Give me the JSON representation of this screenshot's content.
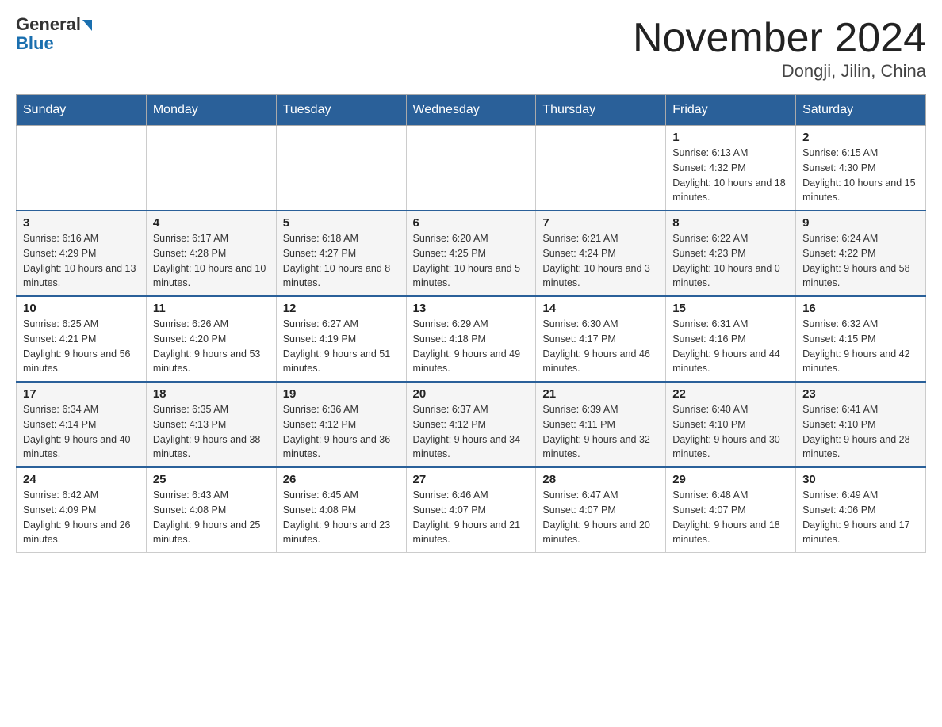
{
  "header": {
    "logo_general": "General",
    "logo_blue": "Blue",
    "title": "November 2024",
    "subtitle": "Dongji, Jilin, China"
  },
  "calendar": {
    "days_of_week": [
      "Sunday",
      "Monday",
      "Tuesday",
      "Wednesday",
      "Thursday",
      "Friday",
      "Saturday"
    ],
    "weeks": [
      [
        {
          "day": "",
          "info": ""
        },
        {
          "day": "",
          "info": ""
        },
        {
          "day": "",
          "info": ""
        },
        {
          "day": "",
          "info": ""
        },
        {
          "day": "",
          "info": ""
        },
        {
          "day": "1",
          "info": "Sunrise: 6:13 AM\nSunset: 4:32 PM\nDaylight: 10 hours and 18 minutes."
        },
        {
          "day": "2",
          "info": "Sunrise: 6:15 AM\nSunset: 4:30 PM\nDaylight: 10 hours and 15 minutes."
        }
      ],
      [
        {
          "day": "3",
          "info": "Sunrise: 6:16 AM\nSunset: 4:29 PM\nDaylight: 10 hours and 13 minutes."
        },
        {
          "day": "4",
          "info": "Sunrise: 6:17 AM\nSunset: 4:28 PM\nDaylight: 10 hours and 10 minutes."
        },
        {
          "day": "5",
          "info": "Sunrise: 6:18 AM\nSunset: 4:27 PM\nDaylight: 10 hours and 8 minutes."
        },
        {
          "day": "6",
          "info": "Sunrise: 6:20 AM\nSunset: 4:25 PM\nDaylight: 10 hours and 5 minutes."
        },
        {
          "day": "7",
          "info": "Sunrise: 6:21 AM\nSunset: 4:24 PM\nDaylight: 10 hours and 3 minutes."
        },
        {
          "day": "8",
          "info": "Sunrise: 6:22 AM\nSunset: 4:23 PM\nDaylight: 10 hours and 0 minutes."
        },
        {
          "day": "9",
          "info": "Sunrise: 6:24 AM\nSunset: 4:22 PM\nDaylight: 9 hours and 58 minutes."
        }
      ],
      [
        {
          "day": "10",
          "info": "Sunrise: 6:25 AM\nSunset: 4:21 PM\nDaylight: 9 hours and 56 minutes."
        },
        {
          "day": "11",
          "info": "Sunrise: 6:26 AM\nSunset: 4:20 PM\nDaylight: 9 hours and 53 minutes."
        },
        {
          "day": "12",
          "info": "Sunrise: 6:27 AM\nSunset: 4:19 PM\nDaylight: 9 hours and 51 minutes."
        },
        {
          "day": "13",
          "info": "Sunrise: 6:29 AM\nSunset: 4:18 PM\nDaylight: 9 hours and 49 minutes."
        },
        {
          "day": "14",
          "info": "Sunrise: 6:30 AM\nSunset: 4:17 PM\nDaylight: 9 hours and 46 minutes."
        },
        {
          "day": "15",
          "info": "Sunrise: 6:31 AM\nSunset: 4:16 PM\nDaylight: 9 hours and 44 minutes."
        },
        {
          "day": "16",
          "info": "Sunrise: 6:32 AM\nSunset: 4:15 PM\nDaylight: 9 hours and 42 minutes."
        }
      ],
      [
        {
          "day": "17",
          "info": "Sunrise: 6:34 AM\nSunset: 4:14 PM\nDaylight: 9 hours and 40 minutes."
        },
        {
          "day": "18",
          "info": "Sunrise: 6:35 AM\nSunset: 4:13 PM\nDaylight: 9 hours and 38 minutes."
        },
        {
          "day": "19",
          "info": "Sunrise: 6:36 AM\nSunset: 4:12 PM\nDaylight: 9 hours and 36 minutes."
        },
        {
          "day": "20",
          "info": "Sunrise: 6:37 AM\nSunset: 4:12 PM\nDaylight: 9 hours and 34 minutes."
        },
        {
          "day": "21",
          "info": "Sunrise: 6:39 AM\nSunset: 4:11 PM\nDaylight: 9 hours and 32 minutes."
        },
        {
          "day": "22",
          "info": "Sunrise: 6:40 AM\nSunset: 4:10 PM\nDaylight: 9 hours and 30 minutes."
        },
        {
          "day": "23",
          "info": "Sunrise: 6:41 AM\nSunset: 4:10 PM\nDaylight: 9 hours and 28 minutes."
        }
      ],
      [
        {
          "day": "24",
          "info": "Sunrise: 6:42 AM\nSunset: 4:09 PM\nDaylight: 9 hours and 26 minutes."
        },
        {
          "day": "25",
          "info": "Sunrise: 6:43 AM\nSunset: 4:08 PM\nDaylight: 9 hours and 25 minutes."
        },
        {
          "day": "26",
          "info": "Sunrise: 6:45 AM\nSunset: 4:08 PM\nDaylight: 9 hours and 23 minutes."
        },
        {
          "day": "27",
          "info": "Sunrise: 6:46 AM\nSunset: 4:07 PM\nDaylight: 9 hours and 21 minutes."
        },
        {
          "day": "28",
          "info": "Sunrise: 6:47 AM\nSunset: 4:07 PM\nDaylight: 9 hours and 20 minutes."
        },
        {
          "day": "29",
          "info": "Sunrise: 6:48 AM\nSunset: 4:07 PM\nDaylight: 9 hours and 18 minutes."
        },
        {
          "day": "30",
          "info": "Sunrise: 6:49 AM\nSunset: 4:06 PM\nDaylight: 9 hours and 17 minutes."
        }
      ]
    ]
  }
}
